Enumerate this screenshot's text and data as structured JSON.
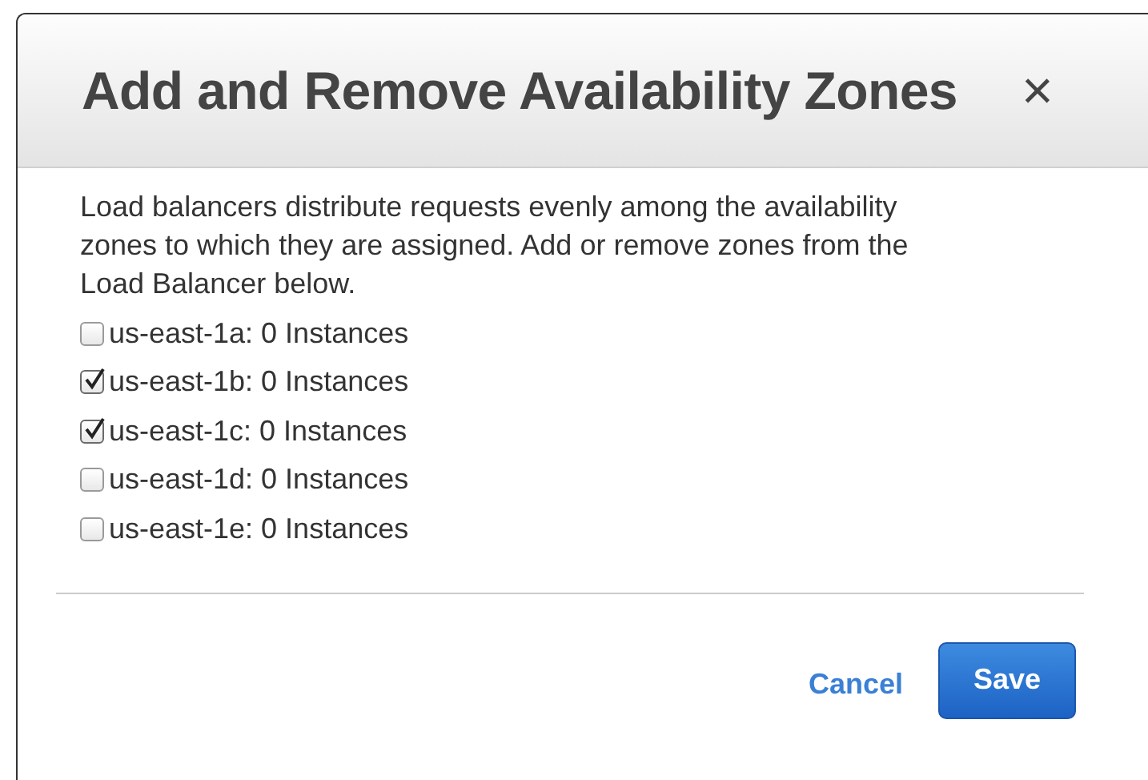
{
  "dialog": {
    "title": "Add and Remove Availability Zones",
    "close": "×",
    "description": "Load balancers distribute requests evenly among the availability zones to which they are assigned. Add or remove zones from the Load Balancer below.",
    "zones": [
      {
        "label": "us-east-1a: 0 Instances",
        "checked": false
      },
      {
        "label": "us-east-1b: 0 Instances",
        "checked": true
      },
      {
        "label": "us-east-1c: 0 Instances",
        "checked": true
      },
      {
        "label": "us-east-1d: 0 Instances",
        "checked": false
      },
      {
        "label": "us-east-1e: 0 Instances",
        "checked": false
      }
    ],
    "buttons": [
      {
        "label": "Cancel",
        "kind": "link"
      },
      {
        "label": "Save",
        "kind": "primary"
      }
    ]
  }
}
